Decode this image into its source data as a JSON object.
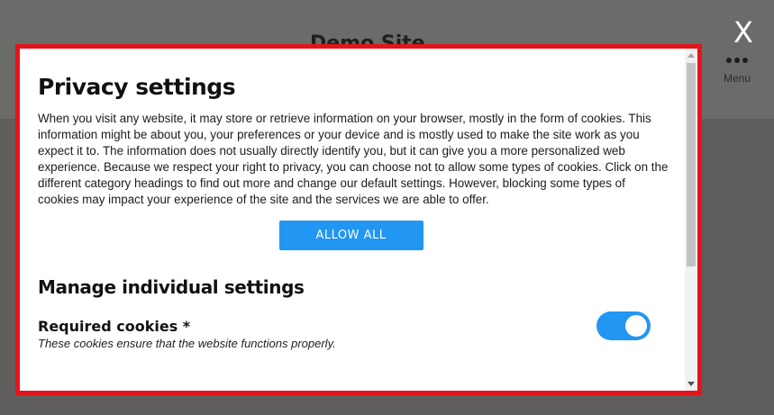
{
  "site": {
    "title": "Demo Site",
    "menu_label": "Menu"
  },
  "close_label": "X",
  "modal": {
    "title": "Privacy settings",
    "intro": "When you visit any website, it may store or retrieve information on your browser, mostly in the form of cookies. This information might be about you, your preferences or your device and is mostly used to make the site work as you expect it to. The information does not usually directly identify you, but it can give you a more personalized web experience. Because we respect your right to privacy, you can choose not to allow some types of cookies. Click on the different category headings to find out more and change our default settings. However, blocking some types of cookies may impact your experience of the site and the services we are able to offer.",
    "allow_all_label": "ALLOW ALL",
    "manage_heading": "Manage individual settings",
    "categories": [
      {
        "title": "Required cookies *",
        "description": "These cookies ensure that the website functions properly.",
        "enabled": true
      }
    ]
  },
  "colors": {
    "accent": "#2196f3",
    "modal_border": "#e3141b"
  },
  "icons": {
    "menu": "dots-icon",
    "close": "close-icon"
  }
}
